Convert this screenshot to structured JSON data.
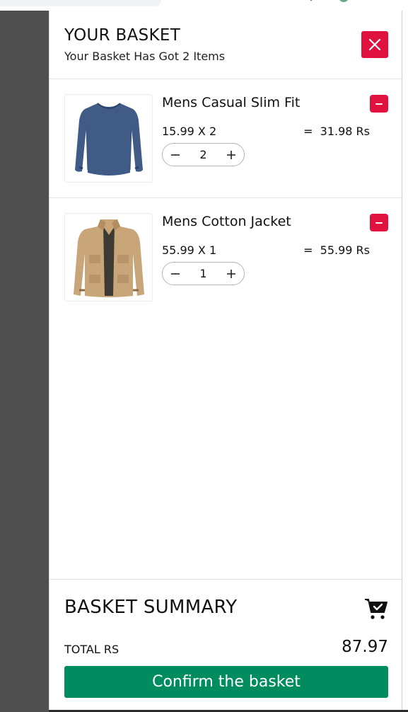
{
  "header": {
    "title": "YOUR BASKET",
    "subtitle": "Your Basket Has Got 2 Items",
    "close_icon": "close-icon"
  },
  "items": [
    {
      "name": "Mens Casual Slim Fit",
      "unit_line": "15.99 X 2",
      "line_total": "=  31.98 Rs",
      "quantity": "2",
      "image": "blue-long-sleeve-shirt"
    },
    {
      "name": "Mens Cotton Jacket",
      "unit_line": "55.99 X 1",
      "line_total": "=  55.99 Rs",
      "quantity": "1",
      "image": "khaki-cotton-jacket"
    }
  ],
  "summary": {
    "title": "BASKET SUMMARY",
    "total_label": "TOTAL RS",
    "total_value": "87.97",
    "confirm_label": "Confirm the basket",
    "cart_icon": "cart-check-icon"
  },
  "colors": {
    "danger": "#e0103f",
    "confirm": "#008c5e",
    "overlay": "#4f4f4f"
  }
}
